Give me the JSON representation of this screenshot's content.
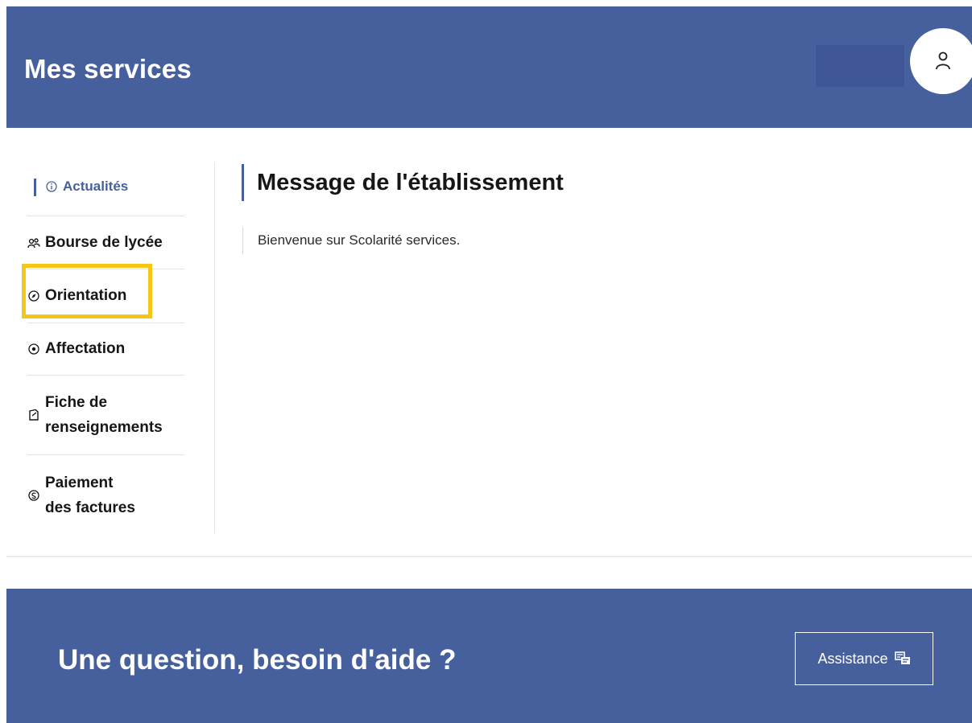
{
  "header": {
    "title": "Mes services",
    "avatar_icon": "user-icon"
  },
  "sidebar": {
    "items": [
      {
        "label": "Actualités",
        "icon": "info-icon",
        "active": true
      },
      {
        "label": "Bourse de lycée",
        "icon": "grant-icon"
      },
      {
        "label": "Orientation",
        "icon": "compass-icon",
        "highlighted": true
      },
      {
        "label": "Affectation",
        "icon": "target-icon"
      },
      {
        "label": "Fiche de renseignements",
        "icon": "form-icon"
      },
      {
        "label": "Paiement des factures",
        "icon": "payment-icon"
      }
    ]
  },
  "main": {
    "title": "Message de l'établissement",
    "message": "Bienvenue sur Scolarité services."
  },
  "help": {
    "title": "Une question, besoin d'aide ?",
    "button_label": "Assistance",
    "button_icon": "assistance-icon"
  },
  "colors": {
    "brand_blue": "#465f9d",
    "highlight_yellow": "#f5c518",
    "text_dark": "#161616"
  }
}
